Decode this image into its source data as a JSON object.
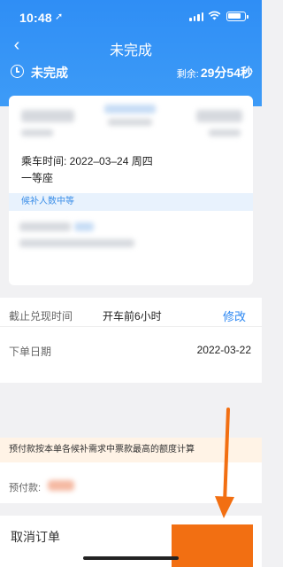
{
  "status_bar": {
    "time": "10:48",
    "location_arrow": "➚"
  },
  "nav": {
    "back_glyph": "‹",
    "title": "未完成"
  },
  "order_status": {
    "label": "未完成",
    "remaining_label": "剩余:",
    "remaining_value": "29分54秒"
  },
  "ticket": {
    "ride_time": "乘车时间: 2022–03–24 周四",
    "seat_class": "一等座",
    "candidate_text": "候补人数中等"
  },
  "details": {
    "deadline_label": "截止兑现时间",
    "deadline_value": "开车前6小时",
    "edit_label": "修改",
    "order_date_label": "下单日期",
    "order_date_value": "2022-03-22"
  },
  "notice": "预付款按本单各候补需求中票款最高的额度计算",
  "prepay_label": "预付款:",
  "bottom_bar": {
    "cancel_label": "取消订单"
  },
  "colors": {
    "header_blue": "#2f8ef5",
    "accent_orange": "#f26f12",
    "link_blue": "#2a86f2"
  }
}
